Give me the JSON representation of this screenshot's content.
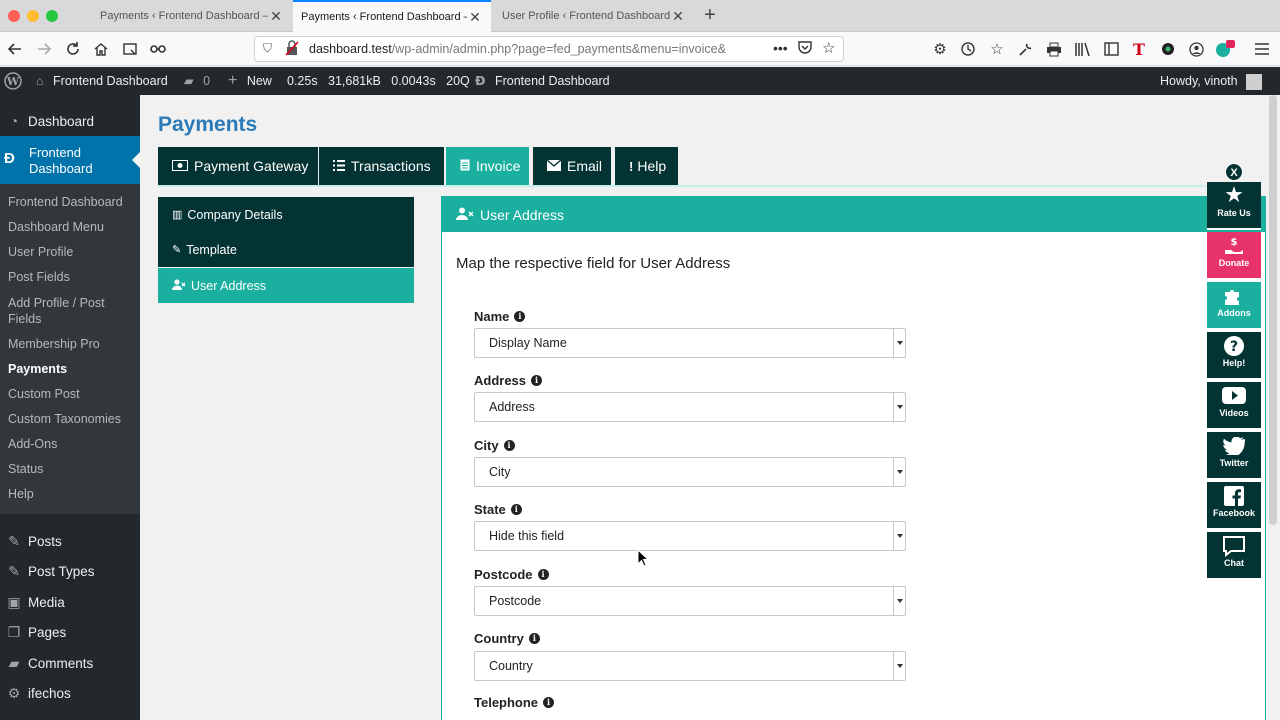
{
  "browser": {
    "tabs": [
      {
        "title": "Payments ‹ Frontend Dashboard —",
        "active": false
      },
      {
        "title": "Payments ‹ Frontend Dashboard —",
        "active": true
      },
      {
        "title": "User Profile ‹ Frontend Dashboard",
        "active": false
      }
    ],
    "url_main": "dashboard.test",
    "url_rest": "/wp-admin/admin.php?page=fed_payments&menu=invoice&"
  },
  "adminbar": {
    "site": "Frontend Dashboard",
    "comments": "0",
    "new": "New",
    "stats": "0.25s   31,681kB   0.0043s   20Q",
    "plugin": "Frontend Dashboard",
    "howdy": "Howdy, vinoth"
  },
  "sidebar": {
    "dashboard": "Dashboard",
    "current": "Frontend Dashboard",
    "submenu": [
      "Frontend Dashboard",
      "Dashboard Menu",
      "User Profile",
      "Post Fields",
      "Add Profile / Post Fields",
      "Membership Pro",
      "Payments",
      "Custom Post",
      "Custom Taxonomies",
      "Add-Ons",
      "Status",
      "Help"
    ],
    "menu": [
      "Posts",
      "Post Types",
      "Media",
      "Pages",
      "Comments",
      "ifechos"
    ]
  },
  "page": {
    "title": "Payments",
    "tabs": [
      "Payment Gateway",
      "Transactions",
      "Invoice",
      "Email",
      "Help"
    ],
    "active_tab": "Invoice",
    "subtabs": [
      "Company Details",
      "Template",
      "User Address"
    ],
    "active_subtab": "User Address"
  },
  "panel": {
    "title": "User Address",
    "description": "Map the respective field for User Address",
    "fields": [
      {
        "label": "Name",
        "value": "Display Name"
      },
      {
        "label": "Address",
        "value": "Address"
      },
      {
        "label": "City",
        "value": "City"
      },
      {
        "label": "State",
        "value": "Hide this field"
      },
      {
        "label": "Postcode",
        "value": "Postcode"
      },
      {
        "label": "Country",
        "value": "Country"
      },
      {
        "label": "Telephone",
        "value": ""
      }
    ]
  },
  "widget": {
    "close": "X",
    "buttons": [
      "Rate Us",
      "Donate",
      "Addons",
      "Help!",
      "Videos",
      "Twitter",
      "Facebook",
      "Chat"
    ]
  },
  "colors": {
    "accent": "#1bafa0",
    "dark": "#033333",
    "wp_blue": "#0073aa",
    "donate": "#e8336a"
  }
}
